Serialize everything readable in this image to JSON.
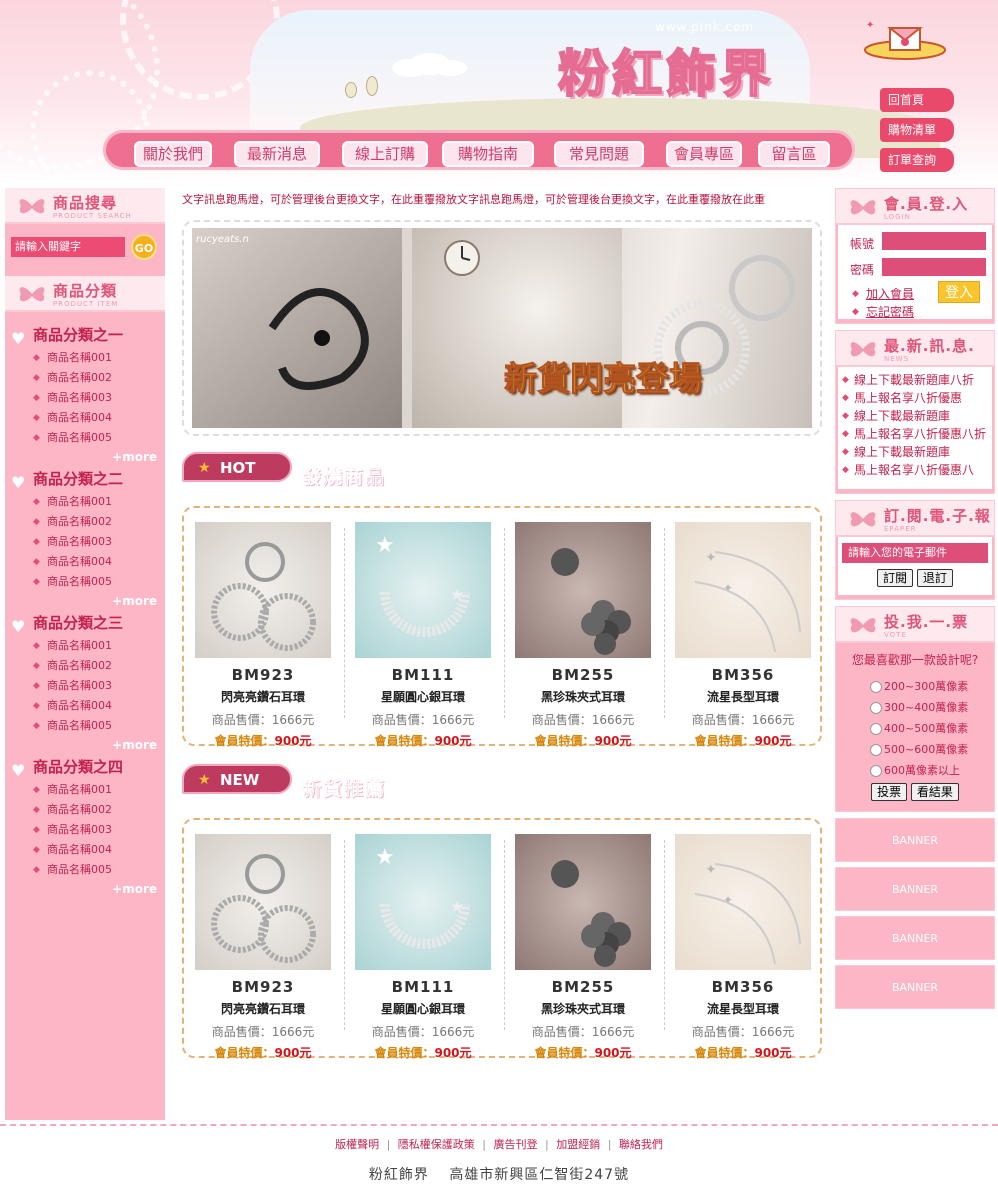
{
  "header": {
    "site_url": "www.pink.com",
    "logo_text": "粉紅飾界",
    "nav": [
      "關於我們",
      "最新消息",
      "線上訂購",
      "購物指南",
      "常見問題",
      "會員專區",
      "留言區"
    ],
    "top_links": [
      "回首頁",
      "購物清單",
      "訂單查詢"
    ]
  },
  "search": {
    "title": "商品搜尋",
    "subtitle": "PRODUCT SEARCH",
    "placeholder": "請輸入關鍵字",
    "go": "GO"
  },
  "categories": {
    "title": "商品分類",
    "subtitle": "PRODUCT ITEM",
    "more": "+more",
    "groups": [
      {
        "name": "商品分類之一",
        "items": [
          "商品名稱001",
          "商品名稱002",
          "商品名稱003",
          "商品名稱004",
          "商品名稱005"
        ]
      },
      {
        "name": "商品分類之二",
        "items": [
          "商品名稱001",
          "商品名稱002",
          "商品名稱003",
          "商品名稱004",
          "商品名稱005"
        ]
      },
      {
        "name": "商品分類之三",
        "items": [
          "商品名稱001",
          "商品名稱002",
          "商品名稱003",
          "商品名稱004",
          "商品名稱005"
        ]
      },
      {
        "name": "商品分類之四",
        "items": [
          "商品名稱001",
          "商品名稱002",
          "商品名稱003",
          "商品名稱004",
          "商品名稱005"
        ]
      }
    ]
  },
  "marquee": "文字訊息跑馬燈，可於管理後台更換文字，在此重覆撥放文字訊息跑馬燈，可於管理後台更換文字，在此重覆撥放在此重",
  "hero": {
    "text": "新貨閃亮登場",
    "watermark": "rucyeats.n"
  },
  "hot": {
    "tag": "HOT",
    "title": "發燒商品",
    "products": [
      {
        "code": "BM923",
        "name": "閃亮亮鑽石耳環",
        "price": "商品售價：1666元",
        "member_label": "會員特價：",
        "member_price": "900元"
      },
      {
        "code": "BM111",
        "name": "星願圓心銀耳環",
        "price": "商品售價：1666元",
        "member_label": "會員特價：",
        "member_price": "900元"
      },
      {
        "code": "BM255",
        "name": "黑珍珠夾式耳環",
        "price": "商品售價：1666元",
        "member_label": "會員特價：",
        "member_price": "900元"
      },
      {
        "code": "BM356",
        "name": "流星長型耳環",
        "price": "商品售價：1666元",
        "member_label": "會員特價：",
        "member_price": "900元"
      }
    ]
  },
  "new": {
    "tag": "NEW",
    "title": "新貨推薦",
    "products": [
      {
        "code": "BM923",
        "name": "閃亮亮鑽石耳環",
        "price": "商品售價：1666元",
        "member_label": "會員特價：",
        "member_price": "900元"
      },
      {
        "code": "BM111",
        "name": "星願圓心銀耳環",
        "price": "商品售價：1666元",
        "member_label": "會員特價：",
        "member_price": "900元"
      },
      {
        "code": "BM255",
        "name": "黑珍珠夾式耳環",
        "price": "商品售價：1666元",
        "member_label": "會員特價：",
        "member_price": "900元"
      },
      {
        "code": "BM356",
        "name": "流星長型耳環",
        "price": "商品售價：1666元",
        "member_label": "會員特價：",
        "member_price": "900元"
      }
    ]
  },
  "login": {
    "title": "會.員.登.入",
    "subtitle": "LOGIN",
    "account_label": "帳號",
    "password_label": "密碼",
    "join": "加入會員",
    "forgot": "忘記密碼",
    "submit": "登入"
  },
  "news": {
    "title": "最.新.訊.息.",
    "subtitle": "NEWS",
    "items": [
      "線上下載最新題庫八折",
      "馬上報名享八折優惠",
      "線上下載最新題庫",
      "馬上報名享八折優惠八折",
      "線上下載最新題庫",
      "馬上報名享八折優惠八"
    ]
  },
  "epaper": {
    "title": "訂.閱.電.子.報",
    "subtitle": "EPAPER",
    "placeholder": "請輸入您的電子郵件",
    "subscribe": "訂閱",
    "unsubscribe": "退訂"
  },
  "vote": {
    "title": "投.我.一.票",
    "subtitle": "VOTE",
    "question": "您最喜歡那一款設計呢?",
    "options": [
      "200~300萬像素",
      "300~400萬像素",
      "400~500萬像素",
      "500~600萬像素",
      "600萬像素以上"
    ],
    "vote_btn": "投票",
    "result_btn": "看結果"
  },
  "banners": [
    "BANNER",
    "BANNER",
    "BANNER",
    "BANNER"
  ],
  "footer": {
    "links": [
      "版權聲明",
      "隱私權保護政策",
      "廣告刊登",
      "加盟經銷",
      "聯絡我們"
    ],
    "address": "粉紅飾界　 高雄市新興區仁智街247號"
  },
  "colors": {
    "pink_main": "#fdb6c5",
    "accent": "#e94a6c",
    "text_red": "#c2224f",
    "gold": "#d9860b"
  }
}
